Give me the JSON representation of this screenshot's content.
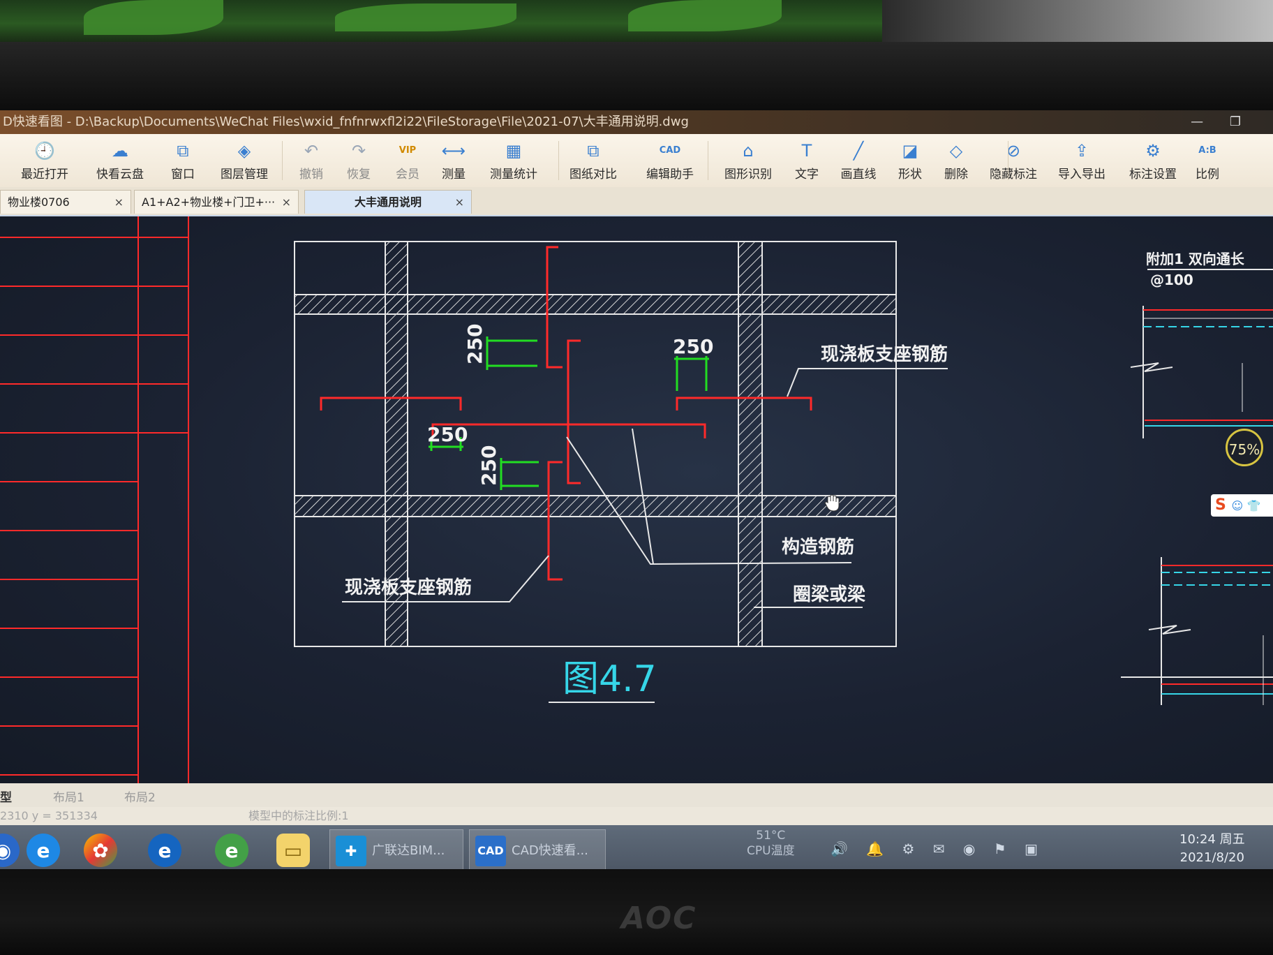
{
  "window": {
    "title": "D快速看图 - D:\\Backup\\Documents\\WeChat Files\\wxid_fnfnrwxfl2i22\\FileStorage\\File\\2021-07\\大丰通用说明.dwg",
    "controls": "— ❐"
  },
  "toolbar": {
    "items": [
      {
        "label": "最近打开",
        "icon": "clock-icon",
        "glyph": "🕘"
      },
      {
        "label": "快看云盘",
        "icon": "cloud-icon",
        "glyph": "☁"
      },
      {
        "label": "窗口",
        "icon": "window-icon",
        "glyph": "⧉"
      },
      {
        "label": "图层管理",
        "icon": "layers-icon",
        "glyph": "◈"
      },
      {
        "label": "撤销",
        "icon": "undo-icon",
        "glyph": "↶"
      },
      {
        "label": "恢复",
        "icon": "redo-icon",
        "glyph": "↷"
      },
      {
        "label": "会员",
        "icon": "vip-icon",
        "glyph": "VIP"
      },
      {
        "label": "测量",
        "icon": "ruler-icon",
        "glyph": "⟷"
      },
      {
        "label": "测量统计",
        "icon": "measure-stats-icon",
        "glyph": "▦"
      },
      {
        "label": "图纸对比",
        "icon": "compare-icon",
        "glyph": "⧉"
      },
      {
        "label": "编辑助手",
        "icon": "cad-edit-icon",
        "glyph": "CAD"
      },
      {
        "label": "图形识别",
        "icon": "shape-recognize-icon",
        "glyph": "⌂"
      },
      {
        "label": "文字",
        "icon": "text-icon",
        "glyph": "T"
      },
      {
        "label": "画直线",
        "icon": "line-icon",
        "glyph": "╱"
      },
      {
        "label": "形状",
        "icon": "shape-icon",
        "glyph": "◪"
      },
      {
        "label": "删除",
        "icon": "eraser-icon",
        "glyph": "◇"
      },
      {
        "label": "隐藏标注",
        "icon": "hide-eye-icon",
        "glyph": "⊘"
      },
      {
        "label": "导入导出",
        "icon": "import-export-icon",
        "glyph": "⇪"
      },
      {
        "label": "标注设置",
        "icon": "settings-icon",
        "glyph": "⚙"
      },
      {
        "label": "比例",
        "icon": "scale-icon",
        "glyph": "A:B"
      }
    ]
  },
  "tabs": [
    {
      "label": "物业楼0706",
      "close": "×"
    },
    {
      "label": "A1+A2+物业楼+门卫+···",
      "close": "×"
    },
    {
      "label": "大丰通用说明",
      "close": "×"
    }
  ],
  "drawing": {
    "dims": [
      "250",
      "250",
      "250",
      "250"
    ],
    "label_support_top": "现浇板支座钢筋",
    "label_support_bottom": "现浇板支座钢筋",
    "label_construct": "构造钢筋",
    "label_ringbeam": "圈梁或梁",
    "caption": "图4.7",
    "side_label_1": "附加1 双向通长",
    "side_label_2": "@100",
    "colors": {
      "line": "#eeeeee",
      "red": "#ff2a2a",
      "green": "#22dd22",
      "cyan": "#36d6e8",
      "background": "#1b2232"
    }
  },
  "zoom_badge": "75%",
  "ime_label": "S",
  "model_tabs": [
    "型",
    "布局1",
    "布局2"
  ],
  "status": {
    "coords": "2310  y = 351334",
    "scale_note": "模型中的标注比例:1"
  },
  "taskbar": {
    "tasks": [
      {
        "label": "广联达BIM...",
        "icon": "glodon-icon",
        "glyph": "✚"
      },
      {
        "label": "CAD快速看...",
        "icon": "cad-app-icon",
        "glyph": "CAD"
      }
    ],
    "cpu_temp": "51°C",
    "cpu_label": "CPU温度",
    "tray": "🔊 🔔 ⚙ ✉ ◉ ⚑ ▣",
    "clock_time": "10:24 周五",
    "clock_date": "2021/8/20"
  },
  "monitor_brand": "AOC"
}
